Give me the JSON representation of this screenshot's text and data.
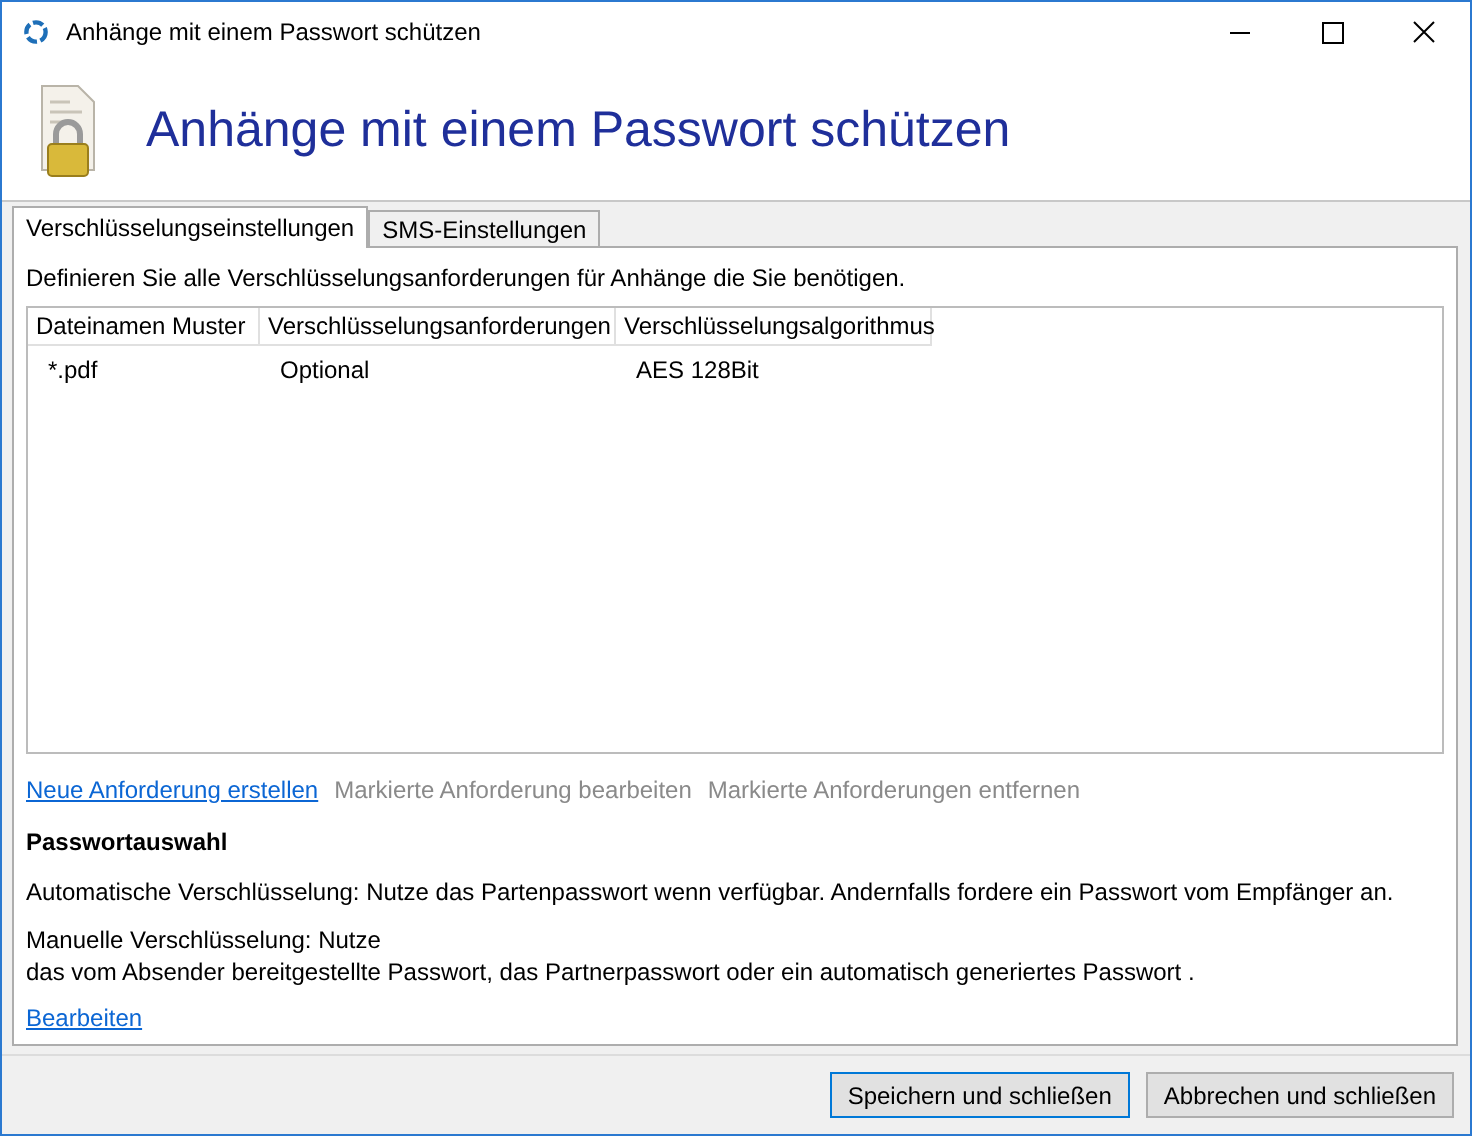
{
  "window": {
    "title": "Anhänge mit einem Passwort schützen"
  },
  "header": {
    "title": "Anhänge mit einem Passwort schützen"
  },
  "tabs": [
    {
      "label": "Verschlüsselungseinstellungen",
      "selected": true
    },
    {
      "label": "SMS-Einstellungen",
      "selected": false
    }
  ],
  "intro": "Definieren Sie alle Verschlüsselungsanforderungen für Anhänge die Sie benötigen.",
  "table": {
    "columns": [
      "Dateinamen Muster",
      "Verschlüsselungsanforderungen",
      "Verschlüsselungsalgorithmus"
    ],
    "rows": [
      {
        "cells": [
          "*.pdf",
          "Optional",
          "AES 128Bit"
        ],
        "selected": false
      }
    ]
  },
  "actions": [
    {
      "label": "Neue Anforderung erstellen",
      "disabled": false
    },
    {
      "label": "Markierte Anforderung bearbeiten",
      "disabled": true
    },
    {
      "label": "Markierte Anforderungen entfernen",
      "disabled": true
    }
  ],
  "password_section": {
    "title": "Passwortauswahl",
    "paragraphs": [
      "Automatische Verschlüsselung: Nutze das Partenpasswort wenn verfügbar. Andernfalls fordere ein Passwort vom Empfänger an.",
      "Manuelle Verschlüsselung: Nutze\ndas vom Absender bereitgestellte Passwort, das Partnerpasswort oder ein automatisch generiertes Passwort ."
    ],
    "edit_link": "Bearbeiten"
  },
  "buttons": [
    {
      "label": "Speichern und schließen",
      "default": true
    },
    {
      "label": "Abbrechen und schließen",
      "default": false
    }
  ]
}
